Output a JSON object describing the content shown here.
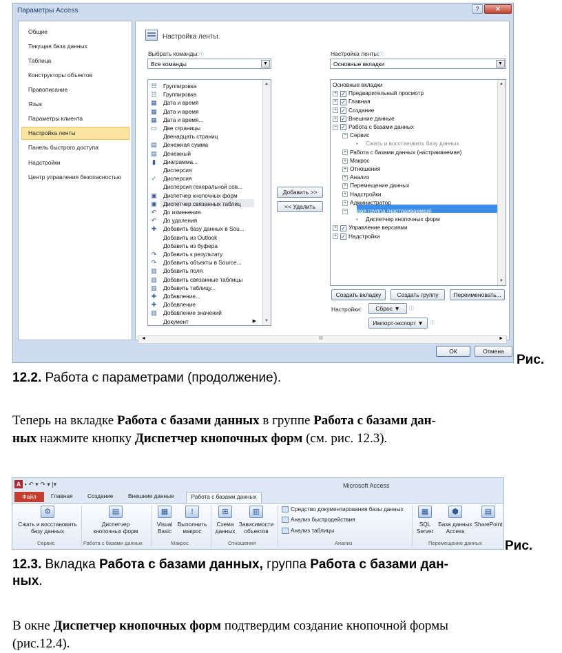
{
  "dialog": {
    "title": "Параметры Access",
    "help_label": "?",
    "close_label": "✕",
    "nav": [
      "Общие",
      "Текущая база данных",
      "Таблица",
      "Конструкторы объектов",
      "Правописание",
      "Язык",
      "Параметры клиента",
      "Настройка ленты",
      "Панель быстрого доступа",
      "Надстройки",
      "Центр управления безопасностью"
    ],
    "header": "Настройка ленты.",
    "choose_label": "Выбрать команды:",
    "choose_value": "Все команды",
    "customize_label": "Настройка ленты:",
    "customize_value": "Основные вкладки",
    "info_glyph": "ⓘ",
    "commands": [
      {
        "icon": "☷",
        "text": "Группировка"
      },
      {
        "icon": "☷",
        "text": "Группировка"
      },
      {
        "icon": "▦",
        "text": "Дата и время"
      },
      {
        "icon": "▦",
        "text": "Дата и время"
      },
      {
        "icon": "▦",
        "text": "Дата и время..."
      },
      {
        "icon": "▭",
        "text": "Две страницы"
      },
      {
        "icon": "",
        "text": "Двенадцать страниц"
      },
      {
        "icon": "▤",
        "text": "Денежная сумма"
      },
      {
        "icon": "▤",
        "text": "Денежный"
      },
      {
        "icon": "▮",
        "text": "Диаграмма..."
      },
      {
        "icon": "",
        "text": "Дисперсия"
      },
      {
        "icon": "✓",
        "text": "Дисперсия"
      },
      {
        "icon": "",
        "text": "Дисперсия генеральной сов..."
      },
      {
        "icon": "▣",
        "text": "Диспетчер кнопочных форм"
      },
      {
        "icon": "▣",
        "text": "Диспетчер связанных таблиц"
      },
      {
        "icon": "↶",
        "text": "До изменения"
      },
      {
        "icon": "↶",
        "text": "До удаления"
      },
      {
        "icon": "✚",
        "text": "Добавить базу данных в Sou..."
      },
      {
        "icon": "",
        "text": "Добавить из Outlook"
      },
      {
        "icon": "",
        "text": "Добавить из буфера"
      },
      {
        "icon": "↷",
        "text": "Добавить к результату"
      },
      {
        "icon": "↷",
        "text": "Добавить объекты в Source..."
      },
      {
        "icon": "▥",
        "text": "Добавить поля"
      },
      {
        "icon": "▥",
        "text": "Добавить связанные таблицы"
      },
      {
        "icon": "▥",
        "text": "Добавить таблицу..."
      },
      {
        "icon": "✚",
        "text": "Добавление..."
      },
      {
        "icon": "✚",
        "text": "Добавление"
      },
      {
        "icon": "▥",
        "text": "Добавление значений"
      },
      {
        "icon": "",
        "text": "Документ"
      }
    ],
    "add_button": "Добавить >>",
    "remove_button": "<< Удалить",
    "tree": [
      {
        "level": 0,
        "pm": "",
        "cb": false,
        "text": "Основные вкладки"
      },
      {
        "level": 0,
        "pm": "+",
        "cb": true,
        "text": "Предварительный просмотр"
      },
      {
        "level": 0,
        "pm": "+",
        "cb": true,
        "text": "Главная"
      },
      {
        "level": 0,
        "pm": "+",
        "cb": true,
        "text": "Создание"
      },
      {
        "level": 0,
        "pm": "+",
        "cb": true,
        "text": "Внешние данные"
      },
      {
        "level": 0,
        "pm": "−",
        "cb": true,
        "text": "Работа с базами данных"
      },
      {
        "level": 1,
        "pm": "−",
        "cb": false,
        "text": "Сервис"
      },
      {
        "level": 2,
        "pm": "",
        "cb": false,
        "text": "Сжать и восстановить базу данных"
      },
      {
        "level": 1,
        "pm": "+",
        "cb": false,
        "text": "Работа с базами данных (настраиваемая)"
      },
      {
        "level": 1,
        "pm": "+",
        "cb": false,
        "text": "Макрос"
      },
      {
        "level": 1,
        "pm": "+",
        "cb": false,
        "text": "Отношения"
      },
      {
        "level": 1,
        "pm": "+",
        "cb": false,
        "text": "Анализ"
      },
      {
        "level": 1,
        "pm": "+",
        "cb": false,
        "text": "Перемещение данных"
      },
      {
        "level": 1,
        "pm": "+",
        "cb": false,
        "text": "Надстройки"
      },
      {
        "level": 1,
        "pm": "+",
        "cb": false,
        "text": "Администратор"
      },
      {
        "level": 1,
        "pm": "−",
        "cb": false,
        "text": "Новая группа (настраиваемая)"
      },
      {
        "level": 2,
        "pm": "",
        "cb": false,
        "text": "Диспетчер кнопочных форм"
      },
      {
        "level": 0,
        "pm": "+",
        "cb": true,
        "text": "Управление версиями"
      },
      {
        "level": 0,
        "pm": "+",
        "cb": true,
        "text": "Надстройки"
      }
    ],
    "new_tab_button": "Создать вкладку",
    "new_group_button": "Создать группу",
    "rename_button": "Переименовать...",
    "settings_label": "Настройки:",
    "reset_button": "Сброс ▼",
    "import_button": "Импорт-экспорт ▼",
    "ok_button": "ОК",
    "cancel_button": "Отмена",
    "hscroll_mark": "III"
  },
  "caption1": {
    "bold_a": "Рис.",
    "bold_b": "12.2.",
    "text": " Работа с параметрами (продолжение)."
  },
  "para1": {
    "p1": "Теперь на вкладке ",
    "b1": "Работа с базами данных",
    "p2": " в группе ",
    "b2": "Работа с базами дан-",
    "b3": "ных",
    "p3": " нажмите кнопку ",
    "b4": "Диспетчер кнопочных форм",
    "p4": " (см. рис. 12.3)."
  },
  "ribbon": {
    "app_title": "Microsoft Access",
    "qat_a": "A",
    "qat_rest": "▪ ↶ ▾ ↷ ▾ |▾",
    "tabs": [
      "Файл",
      "Главная",
      "Создание",
      "Внешние данные",
      "Работа с базами данных"
    ],
    "btn_compact": "Сжать и восстановить базу данных",
    "btn_switchboard": "Диспетчер кнопочных форм",
    "btn_vb": "Visual Basic",
    "btn_run": "Выполнить макрос",
    "btn_schema": "Схема данных",
    "btn_deps": "Зависимости объектов",
    "btn_documenter": "Средство документирования базы данных",
    "btn_perf": "Анализ быстродействия",
    "btn_table": "Анализ таблицы",
    "btn_sql": "SQL Server",
    "btn_access_db": "База данных Access",
    "btn_sharepoint": "SharePoint",
    "groups": [
      "Сервис",
      "Работа с базами данных",
      "Макрос",
      "Отношения",
      "Анализ",
      "Перемещение данных"
    ]
  },
  "caption2": {
    "bold_a": "Рис.",
    "b1": "12.3.",
    "p1": " Вкладка ",
    "b2": "Работа с базами данных,",
    "p2": " группа ",
    "b3": "Работа с базами дан-",
    "b4": "ных",
    "p3": "."
  },
  "para2": {
    "p1": "В окне ",
    "b1": "Диспетчер кнопочных форм",
    "p2": " подтвердим создание кнопочной формы",
    "p3": "(рис.12.4)."
  }
}
